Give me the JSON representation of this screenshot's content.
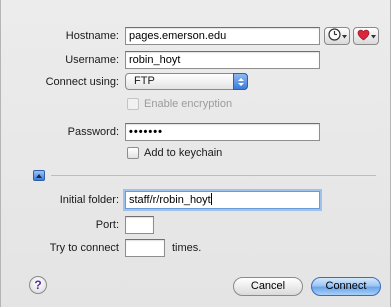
{
  "form": {
    "hostname_label": "Hostname:",
    "hostname_value": "pages.emerson.edu",
    "username_label": "Username:",
    "username_value": "robin_hoyt",
    "connect_using_label": "Connect using:",
    "connect_using_value": "FTP",
    "enable_encryption_label": "Enable encryption",
    "password_label": "Password:",
    "password_value": "•••••••",
    "add_to_keychain_label": "Add to keychain",
    "initial_folder_label": "Initial folder:",
    "initial_folder_value": "staff/r/robin_hoyt",
    "port_label": "Port:",
    "port_value": "",
    "try_to_connect_label": "Try to connect",
    "try_to_connect_value": "",
    "times_label": "times."
  },
  "buttons": {
    "help_label": "?",
    "cancel_label": "Cancel",
    "connect_label": "Connect"
  },
  "icons": {
    "history": "clock-icon",
    "favorites": "heart-icon",
    "disclosure": "disclosure-triangle-up-icon"
  },
  "colors": {
    "accent": "#3d7cda",
    "heart": "#d8263a"
  }
}
